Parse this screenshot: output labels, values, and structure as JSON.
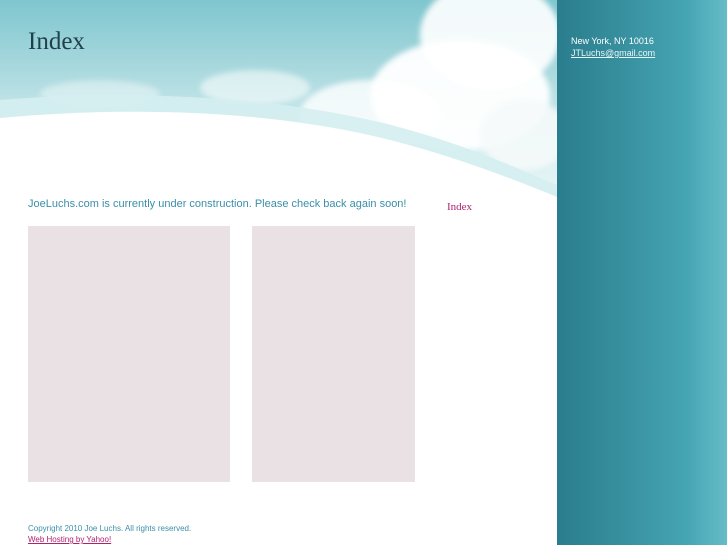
{
  "header": {
    "title": "Index"
  },
  "contact": {
    "address": "New York, NY 10016",
    "email": "JTLuchs@gmail.com"
  },
  "main": {
    "notice": "JoeLuchs.com is currently under construction. Please check back again soon!"
  },
  "nav": {
    "index_label": "Index"
  },
  "footer": {
    "copyright": "Copyright 2010 Joe Luchs. All rights reserved.",
    "hosting_link": "Web Hosting by Yahoo!"
  },
  "colors": {
    "accent_teal": "#3a93a2",
    "link_magenta": "#b0216e",
    "placeholder_box": "#eae1e4",
    "title_text": "#1f3f4a"
  }
}
